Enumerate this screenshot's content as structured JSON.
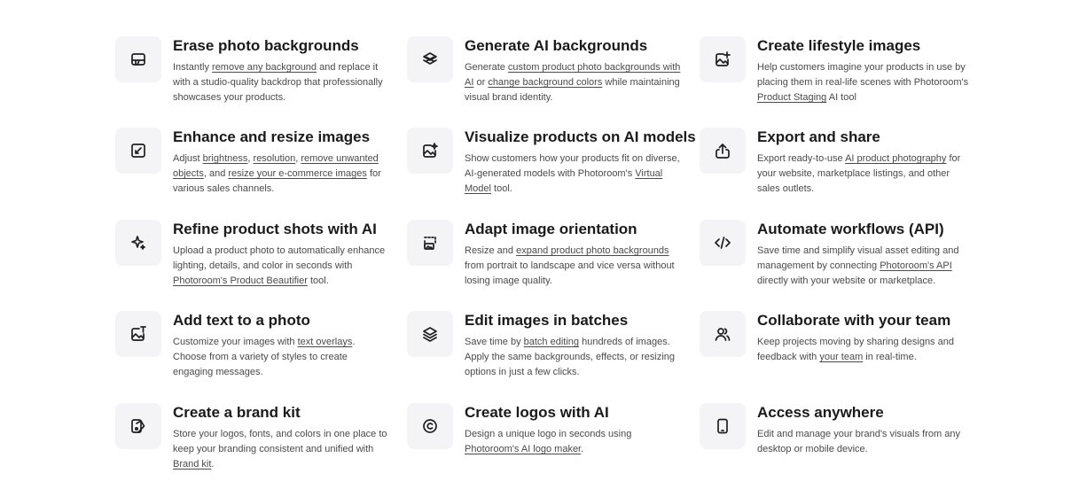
{
  "features": [
    {
      "icon": "erase-background-icon",
      "title": "Erase photo backgrounds",
      "desc": [
        {
          "t": "Instantly "
        },
        {
          "t": "remove any background",
          "link": true
        },
        {
          "t": " and replace it with a studio-quality backdrop that professionally showcases your products."
        }
      ]
    },
    {
      "icon": "layers-stack-icon",
      "title": "Generate AI backgrounds",
      "desc": [
        {
          "t": "Generate "
        },
        {
          "t": "custom product photo backgrounds with AI",
          "link": true
        },
        {
          "t": " or "
        },
        {
          "t": "change background colors",
          "link": true
        },
        {
          "t": " while maintaining visual brand identity."
        }
      ]
    },
    {
      "icon": "image-add-icon",
      "title": "Create lifestyle images",
      "desc": [
        {
          "t": "Help customers imagine your products in use by placing them in real-life scenes with Photoroom's "
        },
        {
          "t": "Product Staging",
          "link": true
        },
        {
          "t": " AI tool"
        }
      ]
    },
    {
      "icon": "resize-image-icon",
      "title": "Enhance and resize images",
      "desc": [
        {
          "t": "Adjust "
        },
        {
          "t": "brightness",
          "link": true
        },
        {
          "t": ", "
        },
        {
          "t": "resolution",
          "link": true
        },
        {
          "t": ", "
        },
        {
          "t": "remove unwanted objects",
          "link": true
        },
        {
          "t": ", and "
        },
        {
          "t": "resize your e-commerce images",
          "link": true
        },
        {
          "t": " for various sales channels."
        }
      ]
    },
    {
      "icon": "image-sparkle-icon",
      "title": "Visualize products on AI models",
      "desc": [
        {
          "t": "Show customers how your products fit on diverse, AI-generated models with Photoroom's "
        },
        {
          "t": "Virtual Model",
          "link": true
        },
        {
          "t": " tool."
        }
      ]
    },
    {
      "icon": "share-export-icon",
      "title": "Export and share",
      "desc": [
        {
          "t": "Export ready-to-use "
        },
        {
          "t": "AI product photography",
          "link": true
        },
        {
          "t": " for your website, marketplace listings, and other sales outlets."
        }
      ]
    },
    {
      "icon": "sparkles-icon",
      "title": "Refine product shots with AI",
      "desc": [
        {
          "t": "Upload a product photo to automatically enhance lighting, details, and color in seconds with "
        },
        {
          "t": "Photoroom's Product Beautifier",
          "link": true
        },
        {
          "t": " tool."
        }
      ]
    },
    {
      "icon": "orientation-icon",
      "title": "Adapt image orientation",
      "desc": [
        {
          "t": "Resize and "
        },
        {
          "t": "expand product photo backgrounds",
          "link": true
        },
        {
          "t": " from portrait to landscape and vice versa without losing image quality."
        }
      ]
    },
    {
      "icon": "code-icon",
      "title": "Automate workflows (API)",
      "desc": [
        {
          "t": "Save time and simplify visual asset editing and management by connecting "
        },
        {
          "t": "Photoroom's API",
          "link": true
        },
        {
          "t": " directly with your website or marketplace."
        }
      ]
    },
    {
      "icon": "image-text-icon",
      "title": "Add text to a photo",
      "desc": [
        {
          "t": "Customize your images with "
        },
        {
          "t": "text overlays",
          "link": true
        },
        {
          "t": ". Choose from a variety of styles to create engaging messages."
        }
      ]
    },
    {
      "icon": "batch-layers-icon",
      "title": "Edit images in batches",
      "desc": [
        {
          "t": "Save time by "
        },
        {
          "t": "batch editing",
          "link": true
        },
        {
          "t": " hundreds of images. Apply the same backgrounds, effects, or resizing options in just a few clicks."
        }
      ]
    },
    {
      "icon": "users-icon",
      "title": "Collaborate with your team",
      "desc": [
        {
          "t": "Keep projects moving by sharing designs and feedback with "
        },
        {
          "t": "your team",
          "link": true
        },
        {
          "t": " in real-time."
        }
      ]
    },
    {
      "icon": "brand-kit-icon",
      "title": "Create a brand kit",
      "desc": [
        {
          "t": "Store your logos, fonts, and colors in one place to keep your branding consistent and unified with "
        },
        {
          "t": "Brand kit",
          "link": true
        },
        {
          "t": "."
        }
      ]
    },
    {
      "icon": "copyright-logo-icon",
      "title": "Create logos with AI",
      "desc": [
        {
          "t": "Design a unique logo in seconds using "
        },
        {
          "t": "Photoroom's AI logo maker",
          "link": true
        },
        {
          "t": "."
        }
      ]
    },
    {
      "icon": "mobile-device-icon",
      "title": "Access anywhere",
      "desc": [
        {
          "t": "Edit and manage your brand's visuals from any desktop or mobile device."
        }
      ]
    }
  ]
}
